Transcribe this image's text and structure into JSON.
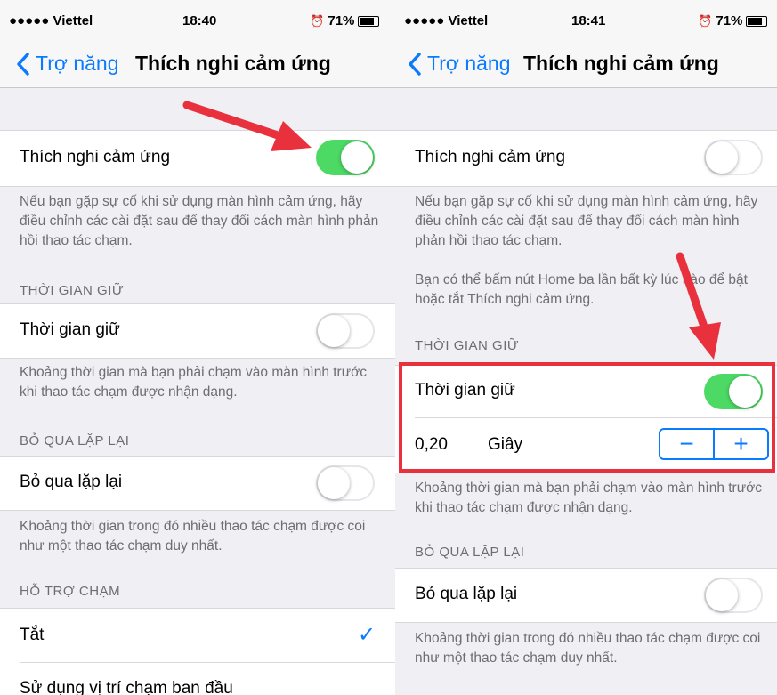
{
  "left": {
    "status": {
      "carrier": "●●●●● Viettel",
      "time": "18:40",
      "battery": "71%"
    },
    "nav": {
      "back": "Trợ năng",
      "title": "Thích nghi cảm ứng"
    },
    "touch_accommodations": {
      "label": "Thích nghi cảm ứng",
      "on": true
    },
    "touch_footer": "Nếu bạn gặp sự cố khi sử dụng màn hình cảm ứng, hãy điều chỉnh các cài đặt sau để thay đổi cách màn hình phản hồi thao tác chạm.",
    "hold_header": "THỜI GIAN GIỮ",
    "hold": {
      "label": "Thời gian giữ",
      "on": false
    },
    "hold_footer": "Khoảng thời gian mà bạn phải chạm vào màn hình trước khi thao tác chạm được nhận dạng.",
    "ignore_header": "BỎ QUA LẶP LẠI",
    "ignore": {
      "label": "Bỏ qua lặp lại",
      "on": false
    },
    "ignore_footer": "Khoảng thời gian trong đó nhiều thao tác chạm được coi như một thao tác chạm duy nhất.",
    "assist_header": "HỖ TRỢ CHẠM",
    "assist_off": {
      "label": "Tắt",
      "selected": true
    },
    "assist_initial": {
      "label": "Sử dụng vị trí chạm ban đầu"
    }
  },
  "right": {
    "status": {
      "carrier": "●●●●● Viettel",
      "time": "18:41",
      "battery": "71%"
    },
    "nav": {
      "back": "Trợ năng",
      "title": "Thích nghi cảm ứng"
    },
    "touch_accommodations": {
      "label": "Thích nghi cảm ứng",
      "on": false
    },
    "touch_footer": "Nếu bạn gặp sự cố khi sử dụng màn hình cảm ứng, hãy điều chỉnh các cài đặt sau để thay đổi cách màn hình phản hồi thao tác chạm.",
    "touch_footer2": "Bạn có thể bấm nút Home ba lần bất kỳ lúc nào để bật hoặc tắt Thích nghi cảm ứng.",
    "hold_header": "THỜI GIAN GIỮ",
    "hold": {
      "label": "Thời gian giữ",
      "on": true
    },
    "hold_value": {
      "number": "0,20",
      "unit": "Giây",
      "minus": "−",
      "plus": "+"
    },
    "hold_footer": "Khoảng thời gian mà bạn phải chạm vào màn hình trước khi thao tác chạm được nhận dạng.",
    "ignore_header": "BỎ QUA LẶP LẠI",
    "ignore": {
      "label": "Bỏ qua lặp lại",
      "on": false
    },
    "ignore_footer": "Khoảng thời gian trong đó nhiều thao tác chạm được coi như một thao tác chạm duy nhất."
  },
  "colors": {
    "tint": "#0a7aff",
    "switch_on": "#4cd964",
    "annotation": "#e8313d"
  }
}
